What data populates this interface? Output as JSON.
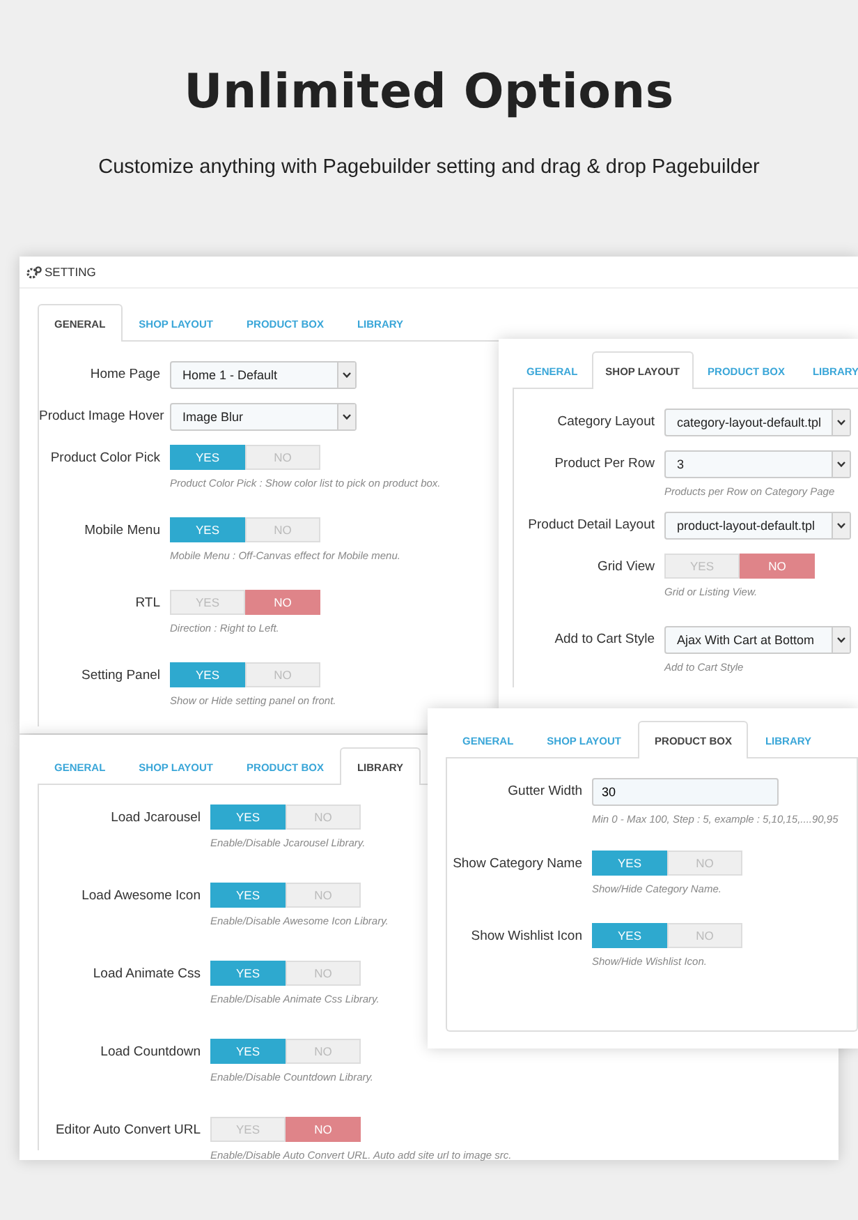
{
  "headline": "Unlimited Options",
  "subtitle": "Customize anything with Pagebuilder setting and drag & drop Pagebuilder",
  "panels": [
    {
      "title": "SETTING",
      "tabs": [
        {
          "label": "GENERAL",
          "selected": true
        },
        {
          "label": "SHOP LAYOUT",
          "selected": false
        },
        {
          "label": "PRODUCT BOX",
          "selected": false
        },
        {
          "label": "LIBRARY",
          "selected": false
        }
      ],
      "rows": [
        {
          "kind": "select",
          "label": "Home Page",
          "value": "Home 1 - Default"
        },
        {
          "kind": "select",
          "label": "Product Image Hover",
          "value": "Image Blur"
        },
        {
          "kind": "toggle",
          "label": "Product Color Pick",
          "options": [
            {
              "label": "YES",
              "selected": true
            },
            {
              "label": "NO",
              "selected": false
            }
          ],
          "help": "Product Color Pick : Show color list to pick on product box."
        },
        {
          "kind": "toggle",
          "label": "Mobile Menu",
          "options": [
            {
              "label": "YES",
              "selected": true
            },
            {
              "label": "NO",
              "selected": false
            }
          ],
          "help": "Mobile Menu : Off-Canvas effect for Mobile menu."
        },
        {
          "kind": "toggle",
          "label": "RTL",
          "options": [
            {
              "label": "YES",
              "selected": false
            },
            {
              "label": "NO",
              "selected": true
            }
          ],
          "help": "Direction : Right to Left."
        },
        {
          "kind": "toggle",
          "label": "Setting Panel",
          "options": [
            {
              "label": "YES",
              "selected": true
            },
            {
              "label": "NO",
              "selected": false
            }
          ],
          "help": "Show or Hide setting panel on front."
        }
      ]
    },
    {
      "tabs": [
        {
          "label": "GENERAL",
          "selected": false
        },
        {
          "label": "SHOP LAYOUT",
          "selected": true
        },
        {
          "label": "PRODUCT BOX",
          "selected": false
        },
        {
          "label": "LIBRARY",
          "selected": false
        }
      ],
      "rows": [
        {
          "kind": "select",
          "label": "Category Layout",
          "value": "category-layout-default.tpl"
        },
        {
          "kind": "select",
          "label": "Product Per Row",
          "value": "3",
          "help": "Products per Row on Category Page"
        },
        {
          "kind": "select",
          "label": "Product Detail Layout",
          "value": "product-layout-default.tpl"
        },
        {
          "kind": "toggle",
          "label": "Grid View",
          "options": [
            {
              "label": "YES",
              "selected": false
            },
            {
              "label": "NO",
              "selected": true
            }
          ],
          "help": "Grid or Listing View."
        },
        {
          "kind": "select",
          "label": "Add to Cart Style",
          "value": "Ajax With Cart at Bottom",
          "help": "Add to Cart Style"
        }
      ]
    },
    {
      "tabs": [
        {
          "label": "GENERAL",
          "selected": false
        },
        {
          "label": "SHOP LAYOUT",
          "selected": false
        },
        {
          "label": "PRODUCT BOX",
          "selected": false
        },
        {
          "label": "LIBRARY",
          "selected": true
        }
      ],
      "rows": [
        {
          "kind": "toggle",
          "label": "Load Jcarousel",
          "options": [
            {
              "label": "YES",
              "selected": true
            },
            {
              "label": "NO",
              "selected": false
            }
          ],
          "help": "Enable/Disable Jcarousel Library."
        },
        {
          "kind": "toggle",
          "label": "Load Awesome Icon",
          "options": [
            {
              "label": "YES",
              "selected": true
            },
            {
              "label": "NO",
              "selected": false
            }
          ],
          "help": "Enable/Disable Awesome Icon Library."
        },
        {
          "kind": "toggle",
          "label": "Load Animate Css",
          "options": [
            {
              "label": "YES",
              "selected": true
            },
            {
              "label": "NO",
              "selected": false
            }
          ],
          "help": "Enable/Disable Animate Css Library."
        },
        {
          "kind": "toggle",
          "label": "Load Countdown",
          "options": [
            {
              "label": "YES",
              "selected": true
            },
            {
              "label": "NO",
              "selected": false
            }
          ],
          "help": "Enable/Disable Countdown Library."
        },
        {
          "kind": "toggle",
          "label": "Editor Auto Convert URL",
          "options": [
            {
              "label": "YES",
              "selected": false
            },
            {
              "label": "NO",
              "selected": true
            }
          ],
          "help": "Enable/Disable Auto Convert URL. Auto add site url to image src."
        }
      ]
    },
    {
      "tabs": [
        {
          "label": "GENERAL",
          "selected": false
        },
        {
          "label": "SHOP LAYOUT",
          "selected": false
        },
        {
          "label": "PRODUCT BOX",
          "selected": true
        },
        {
          "label": "LIBRARY",
          "selected": false
        }
      ],
      "rows": [
        {
          "kind": "input",
          "label": "Gutter Width",
          "value": "30",
          "help": "Min 0 - Max 100, Step : 5, example : 5,10,15,....90,95"
        },
        {
          "kind": "toggle",
          "label": "Show Category Name",
          "options": [
            {
              "label": "YES",
              "selected": true
            },
            {
              "label": "NO",
              "selected": false
            }
          ],
          "help": "Show/Hide Category Name."
        },
        {
          "kind": "toggle",
          "label": "Show Wishlist Icon",
          "options": [
            {
              "label": "YES",
              "selected": true
            },
            {
              "label": "NO",
              "selected": false
            }
          ],
          "help": "Show/Hide Wishlist Icon."
        }
      ]
    }
  ]
}
